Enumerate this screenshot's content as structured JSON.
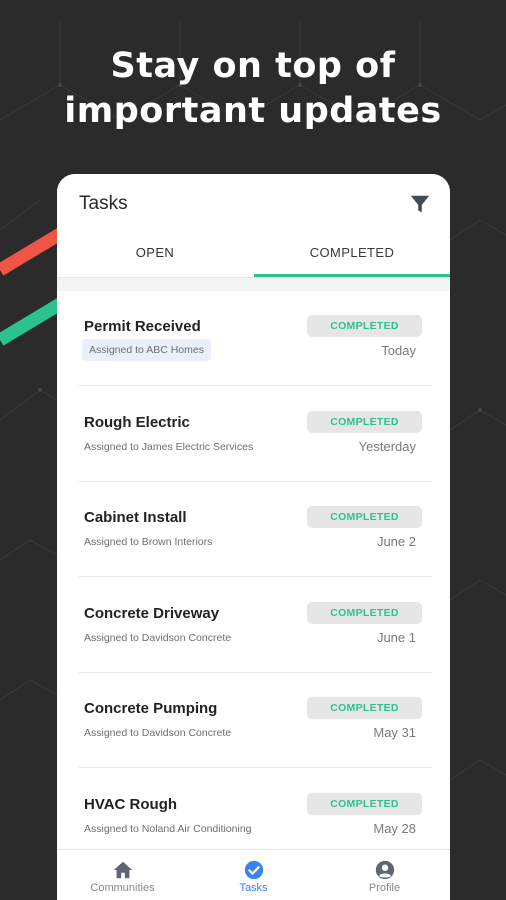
{
  "headline": {
    "line1": "Stay on top of",
    "line2": "important updates"
  },
  "colors": {
    "background": "#2b2b2b",
    "accent_green": "#2ac28e",
    "accent_red": "#f05545",
    "nav_active": "#3b82f6"
  },
  "header": {
    "title": "Tasks",
    "filter_icon": "filter-icon"
  },
  "tabs": [
    {
      "label": "OPEN",
      "active": false
    },
    {
      "label": "COMPLETED",
      "active": true
    }
  ],
  "tasks": [
    {
      "name": "Permit Received",
      "assignee": "Assigned to ABC Homes",
      "status": "COMPLETED",
      "date": "Today"
    },
    {
      "name": "Rough Electric",
      "assignee": "Assigned to James Electric Services",
      "status": "COMPLETED",
      "date": "Yesterday"
    },
    {
      "name": "Cabinet Install",
      "assignee": "Assigned to Brown Interiors",
      "status": "COMPLETED",
      "date": "June 2"
    },
    {
      "name": "Concrete Driveway",
      "assignee": "Assigned to Davidson Concrete",
      "status": "COMPLETED",
      "date": "June 1"
    },
    {
      "name": "Concrete Pumping",
      "assignee": "Assigned to Davidson Concrete",
      "status": "COMPLETED",
      "date": "May 31"
    },
    {
      "name": "HVAC Rough",
      "assignee": "Assigned to Noland Air Conditioning",
      "status": "COMPLETED",
      "date": "May 28"
    }
  ],
  "bottom_nav": [
    {
      "label": "Communities",
      "icon": "home-icon",
      "active": false
    },
    {
      "label": "Tasks",
      "icon": "check-circle-icon",
      "active": true
    },
    {
      "label": "Profile",
      "icon": "profile-icon",
      "active": false
    }
  ]
}
